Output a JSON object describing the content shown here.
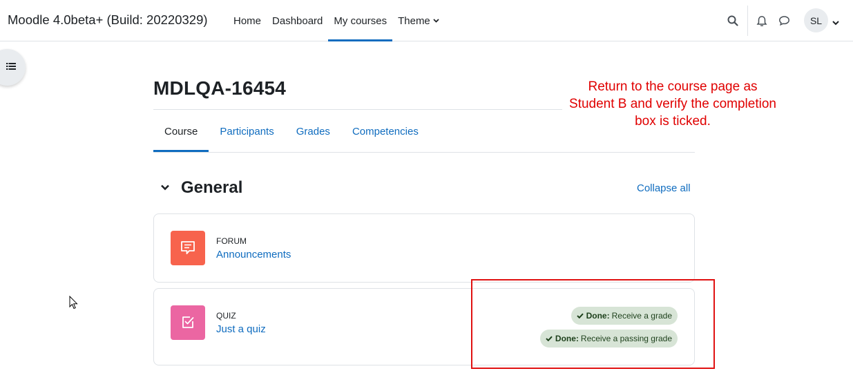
{
  "navbar": {
    "brand": "Moodle 4.0beta+ (Build: 20220329)",
    "links": [
      {
        "label": "Home"
      },
      {
        "label": "Dashboard"
      },
      {
        "label": "My courses",
        "active": true
      },
      {
        "label": "Theme"
      }
    ],
    "user_initials": "SL"
  },
  "page": {
    "title": "MDLQA-16454"
  },
  "annotation": "Return to the course page as Student B and verify the completion box is ticked.",
  "secondary_nav": {
    "tabs": [
      {
        "label": "Course",
        "active": true
      },
      {
        "label": "Participants"
      },
      {
        "label": "Grades"
      },
      {
        "label": "Competencies"
      }
    ]
  },
  "section": {
    "title": "General",
    "collapse_label": "Collapse all"
  },
  "activities": [
    {
      "type": "FORUM",
      "name": "Announcements",
      "icon": "forum-icon",
      "color": "#f7634d"
    },
    {
      "type": "QUIZ",
      "name": "Just a quiz",
      "icon": "quiz-icon",
      "color": "#eb66a2",
      "completion": [
        {
          "status": "Done:",
          "text": "Receive a grade"
        },
        {
          "status": "Done:",
          "text": "Receive a passing grade"
        }
      ]
    }
  ],
  "colors": {
    "accent": "#0f6cbf",
    "annotation": "#e00000",
    "done_badge": "#d7e4d6"
  }
}
